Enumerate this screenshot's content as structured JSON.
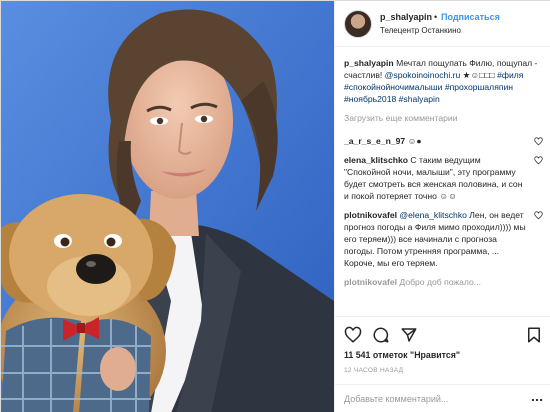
{
  "header": {
    "username": "p_shalyapin",
    "separator": "•",
    "follow_label": "Подписаться",
    "location": "Телецентр Останкино"
  },
  "caption": {
    "username": "p_shalyapin",
    "text": "Мечтал пощупать Филю, пощупал - счастлив! ",
    "mention": "@spokoinoinochi.ru",
    "emoji": "★☺□□□",
    "hashtags": "#филя #спокойнойночималыши #прохоршаляпин #ноябрь2018 #shalyapin"
  },
  "load_more_label": "Загрузить еще комментарии",
  "comments": [
    {
      "username": "_a_r_s_e_n_97",
      "text": " ☺●"
    },
    {
      "username": "elena_klitschko",
      "text": " С таким ведущим \"Спокойной ночи, малыши\", эту программу будет смотреть вся женская половина, и сон и покой потеряет точно ☺☺"
    },
    {
      "username": "plotnikovafel",
      "mention": "@elena_klitschko",
      "text": " Лен, он ведет прогноз погоды а Филя мимо проходил)))) мы его теряем))) все начинали с прогноза погоды. Потом утренняя программа, ... Короче, мы его теряем."
    },
    {
      "username": "plotnikovafel",
      "text": " Добро доб пожало..."
    }
  ],
  "likes_text": "11 541 отметок \"Нравится\"",
  "timestamp": "12 ЧАСОВ НАЗАД",
  "add_comment_placeholder": "Добавьте комментарий...",
  "icons": {
    "like": "heart-icon",
    "comment": "comment-icon",
    "share": "share-icon",
    "save": "bookmark-icon",
    "more": "ellipsis-icon"
  },
  "colors": {
    "link_blue": "#3897f0",
    "mention_blue": "#003569",
    "muted": "#999999",
    "photo_background": "#3a70cc"
  }
}
